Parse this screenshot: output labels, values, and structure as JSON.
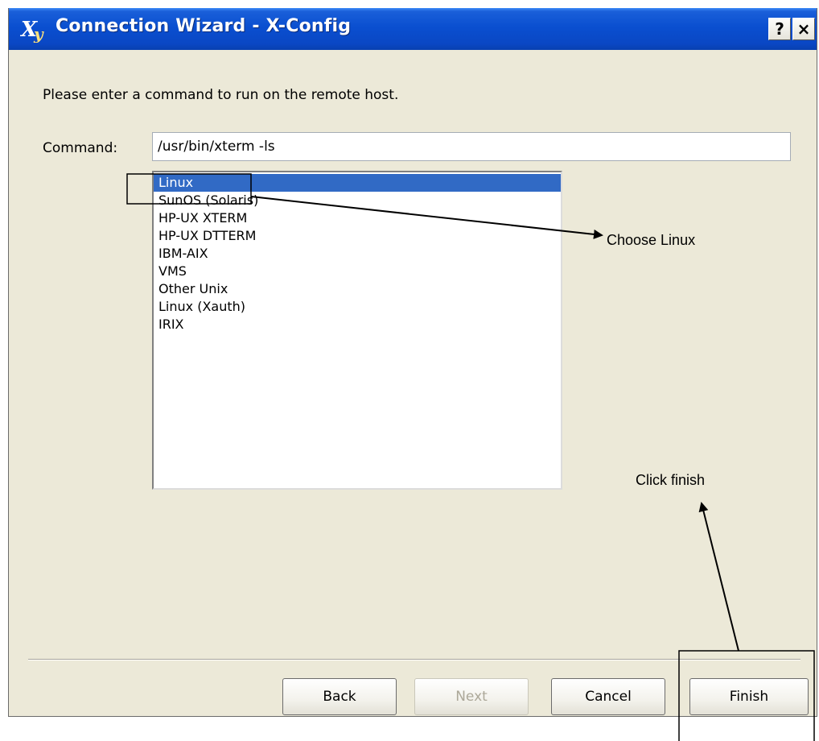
{
  "window": {
    "title": "Connection Wizard - X-Config",
    "logo_icon": "xmanager-logo-icon",
    "help_label": "?",
    "close_label": "×",
    "title_color": "#0a4fd0"
  },
  "form": {
    "instruction": "Please enter a command to run on the remote host.",
    "command_label": "Command:",
    "command_value": "/usr/bin/xterm -ls"
  },
  "list": {
    "items": [
      "Linux",
      "SunOS (Solaris)",
      "HP-UX XTERM",
      "HP-UX DTTERM",
      "IBM-AIX",
      "VMS",
      "Other Unix",
      "Linux (Xauth)",
      "IRIX"
    ],
    "selected": "Linux",
    "selection_color": "#316ac5"
  },
  "buttons": {
    "back": "Back",
    "next": "Next",
    "cancel": "Cancel",
    "finish": "Finish",
    "next_disabled": true
  },
  "annotations": {
    "choose_linux": "Choose Linux",
    "click_finish": "Click finish"
  }
}
